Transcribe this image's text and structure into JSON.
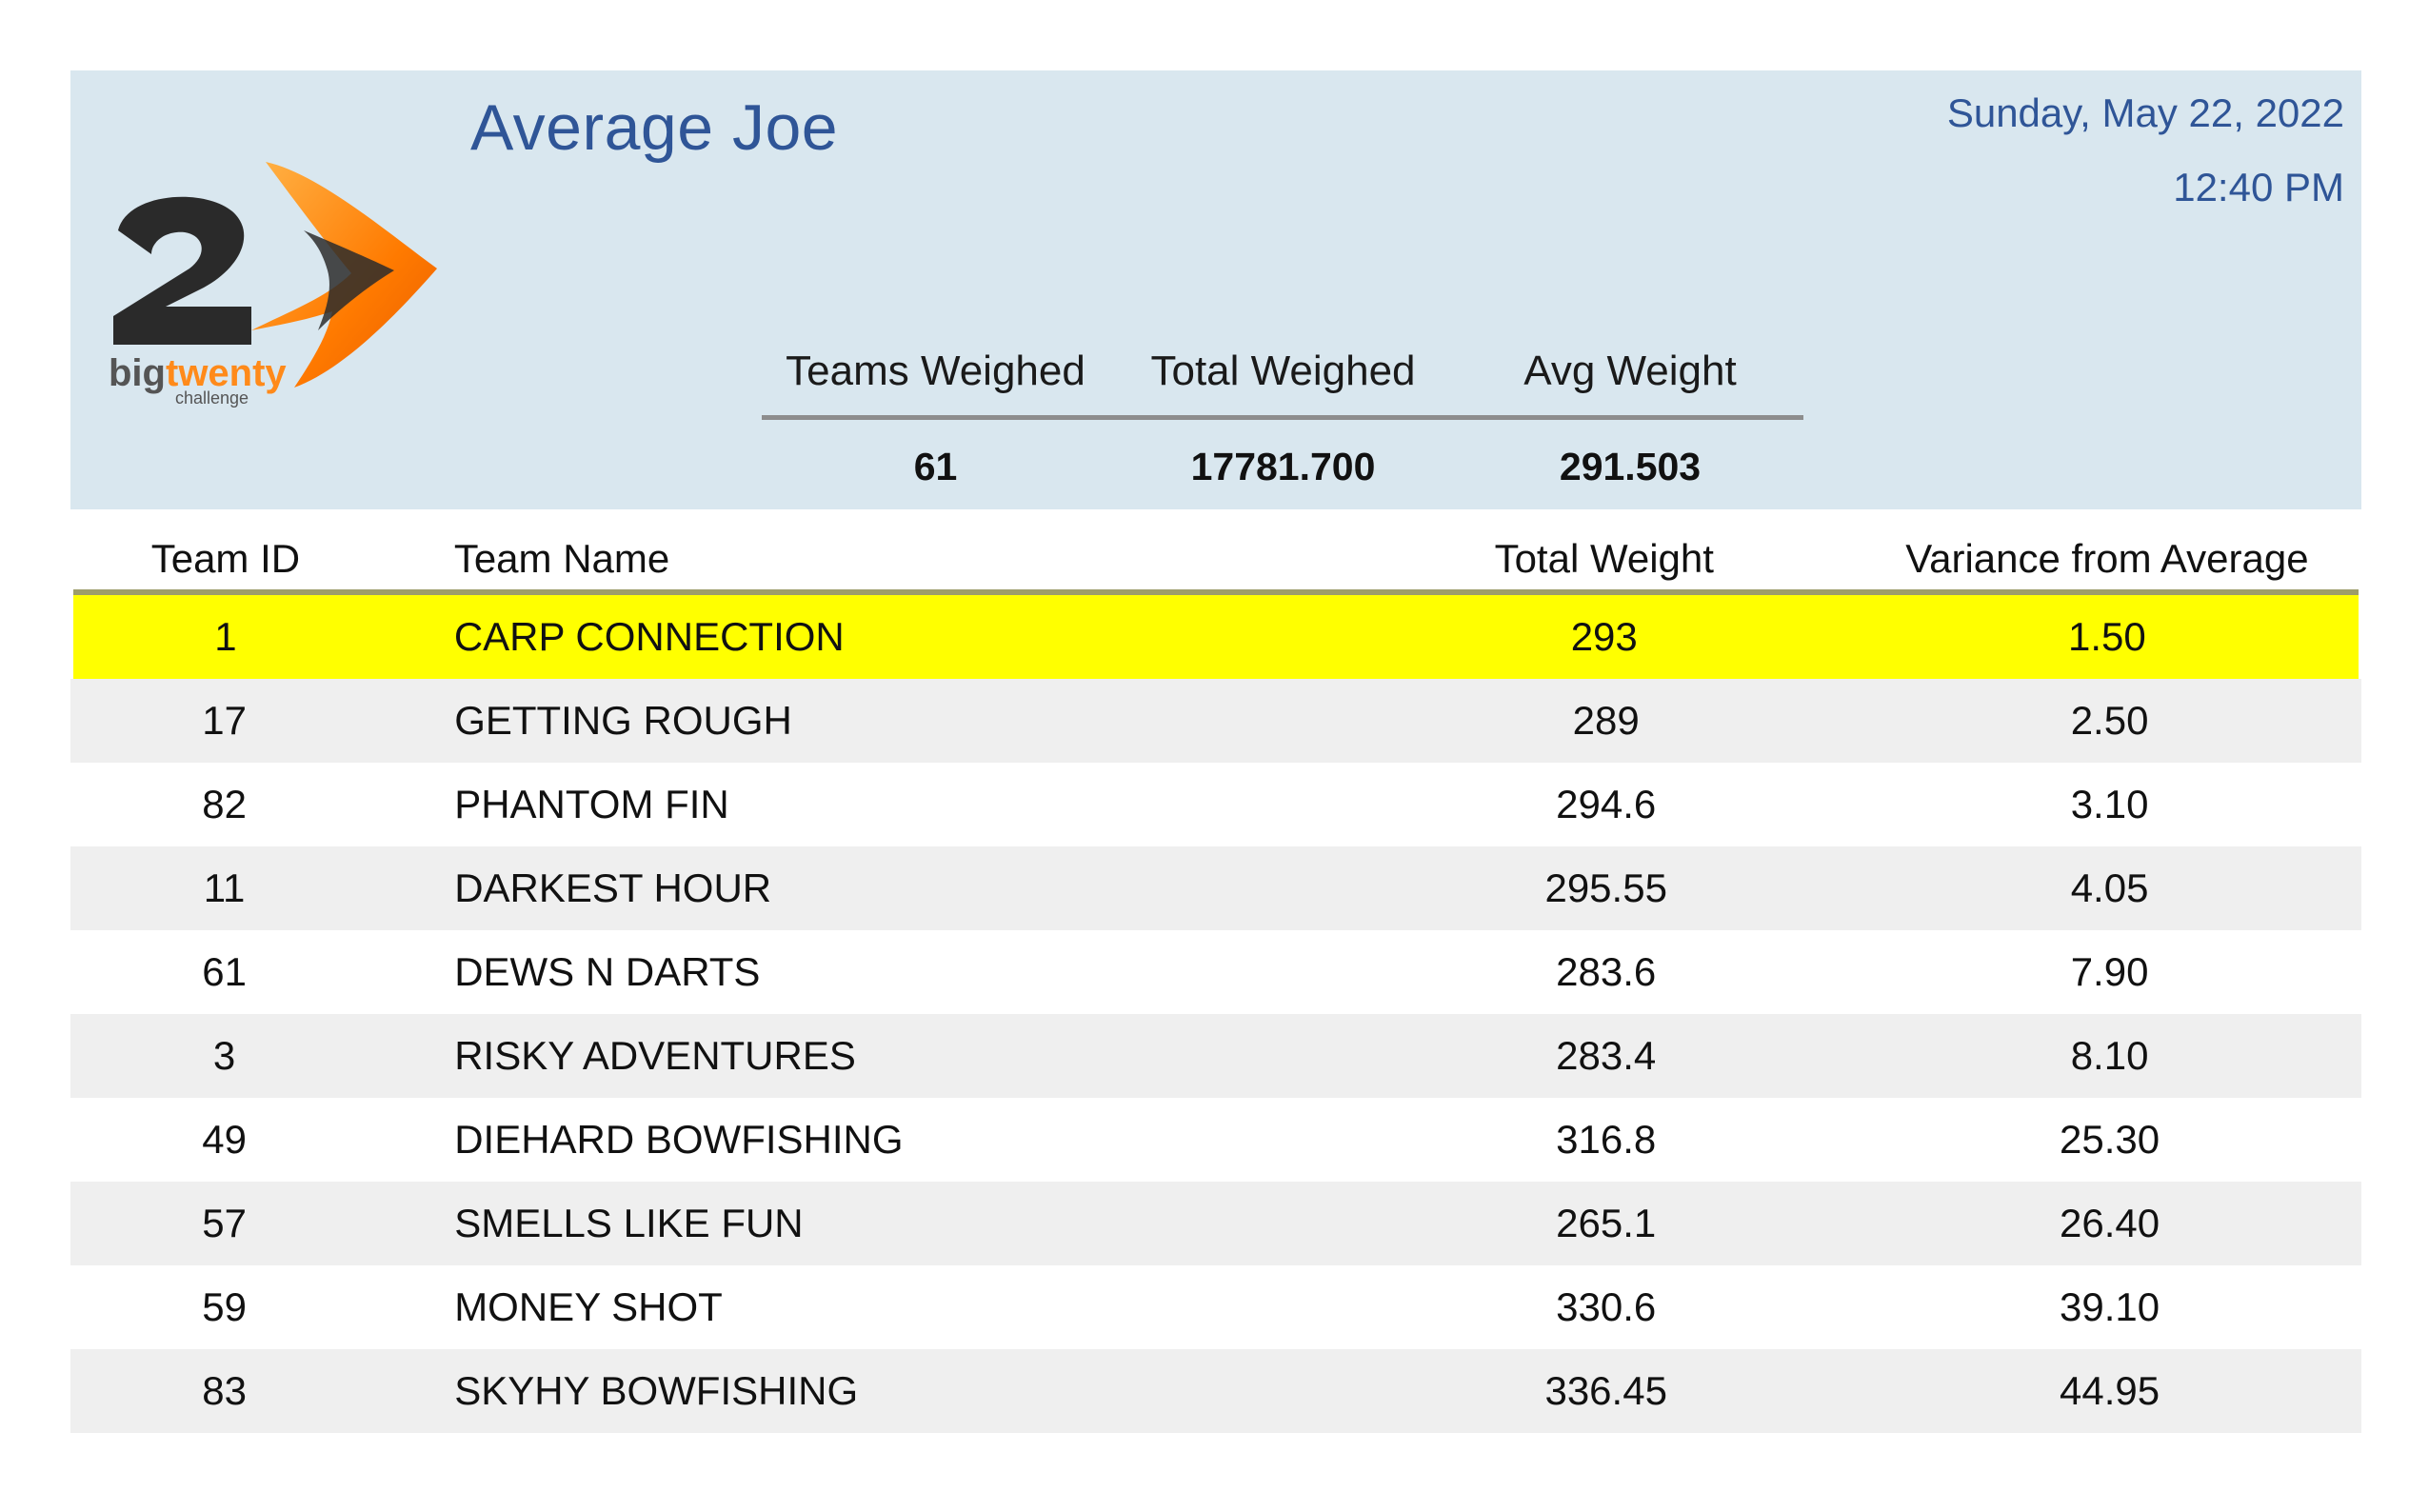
{
  "report": {
    "title": "Average Joe",
    "date": "Sunday, May 22, 2022",
    "time": "12:40 PM",
    "logo_text": "bigtwenty challenge"
  },
  "summary": {
    "headers": [
      "Teams Weighed",
      "Total Weighed",
      "Avg Weight"
    ],
    "values": [
      "61",
      "17781.700",
      "291.503"
    ]
  },
  "table": {
    "columns": [
      "Team ID",
      "Team Name",
      "Total Weight",
      "Variance from Average"
    ],
    "rows": [
      {
        "id": "1",
        "name": "CARP CONNECTION",
        "weight": "293",
        "variance": "1.50"
      },
      {
        "id": "17",
        "name": "GETTING ROUGH",
        "weight": "289",
        "variance": "2.50"
      },
      {
        "id": "82",
        "name": "PHANTOM FIN",
        "weight": "294.6",
        "variance": "3.10"
      },
      {
        "id": "11",
        "name": "DARKEST HOUR",
        "weight": "295.55",
        "variance": "4.05"
      },
      {
        "id": "61",
        "name": "DEWS N DARTS",
        "weight": "283.6",
        "variance": "7.90"
      },
      {
        "id": "3",
        "name": "RISKY ADVENTURES",
        "weight": "283.4",
        "variance": "8.10"
      },
      {
        "id": "49",
        "name": "DIEHARD BOWFISHING",
        "weight": "316.8",
        "variance": "25.30"
      },
      {
        "id": "57",
        "name": "SMELLS LIKE FUN",
        "weight": "265.1",
        "variance": "26.40"
      },
      {
        "id": "59",
        "name": "MONEY SHOT",
        "weight": "330.6",
        "variance": "39.10"
      },
      {
        "id": "83",
        "name": "SKYHY BOWFISHING",
        "weight": "336.45",
        "variance": "44.95"
      }
    ]
  },
  "colors": {
    "header_bg": "#d9e7ef",
    "title": "#2f5597",
    "highlight": "#ffff00",
    "stripe": "#efefef"
  }
}
